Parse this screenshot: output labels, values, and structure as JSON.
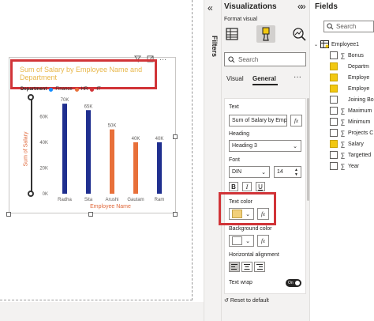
{
  "chart_data": {
    "type": "bar",
    "title": "Sum of Salary by Employee Name and Department",
    "xlabel": "Employee Name",
    "ylabel": "Sum of Salary",
    "legend_title": "Department",
    "legend": [
      "Finance",
      "HR",
      "IT"
    ],
    "categories": [
      "Radha",
      "Sita",
      "Arushi",
      "Gautam",
      "Ram"
    ],
    "values": [
      70000,
      65000,
      50000,
      40000,
      40000
    ],
    "value_labels": [
      "70K",
      "65K",
      "50K",
      "40K",
      "40K"
    ],
    "bar_colors": [
      "#1f2f8f",
      "#1f2f8f",
      "#e8703a",
      "#e8703a",
      "#1f2f8f"
    ],
    "yticks": [
      "0K",
      "20K",
      "40K",
      "60K"
    ],
    "ytick_values": [
      0,
      20000,
      40000,
      60000
    ],
    "ylim": [
      0,
      75000
    ],
    "legend_colors": [
      "#118dff",
      "#e8703a",
      "#d13438"
    ],
    "title_color": "#e8b74a",
    "axis_label_color": "#e0683a"
  },
  "visual_header": {
    "more": "···"
  },
  "filters": {
    "label": "Filters",
    "collapse_icon": "«"
  },
  "visualizations": {
    "title": "Visualizations",
    "collapse_icon": "«",
    "subtitle": "Format visual",
    "search_placeholder": "Search",
    "tabs": [
      "Visual",
      "General"
    ],
    "active_tab": "General",
    "more": "···",
    "text_label": "Text",
    "text_value": "Sum of Salary by Emp",
    "fx": "fx",
    "heading_label": "Heading",
    "heading_value": "Heading 3",
    "font_label": "Font",
    "font_value": "DIN",
    "font_size": "14",
    "bold": "B",
    "italic": "I",
    "underline": "U",
    "text_color_label": "Text color",
    "text_color": "#f2d07a",
    "background_color_label": "Background color",
    "h_align_label": "Horizontal alignment",
    "text_wrap_label": "Text wrap",
    "toggle_on": "On",
    "reset": "Reset to default"
  },
  "fields": {
    "title": "Fields",
    "collapse_icon": "»",
    "search_placeholder": "Search",
    "table": "Employee1",
    "items": [
      {
        "label": "Bonus",
        "checked": false,
        "sigma": true
      },
      {
        "label": "Departm",
        "checked": true,
        "sigma": false
      },
      {
        "label": "Employe",
        "checked": true,
        "sigma": false
      },
      {
        "label": "Employe",
        "checked": true,
        "sigma": false
      },
      {
        "label": "Joining Bo",
        "checked": false,
        "sigma": false
      },
      {
        "label": "Maximum",
        "checked": false,
        "sigma": true
      },
      {
        "label": "Minimum",
        "checked": false,
        "sigma": true
      },
      {
        "label": "Projects C",
        "checked": false,
        "sigma": true
      },
      {
        "label": "Salary",
        "checked": true,
        "sigma": true
      },
      {
        "label": "Targetted",
        "checked": false,
        "sigma": true
      },
      {
        "label": "Year",
        "checked": false,
        "sigma": true
      }
    ]
  }
}
